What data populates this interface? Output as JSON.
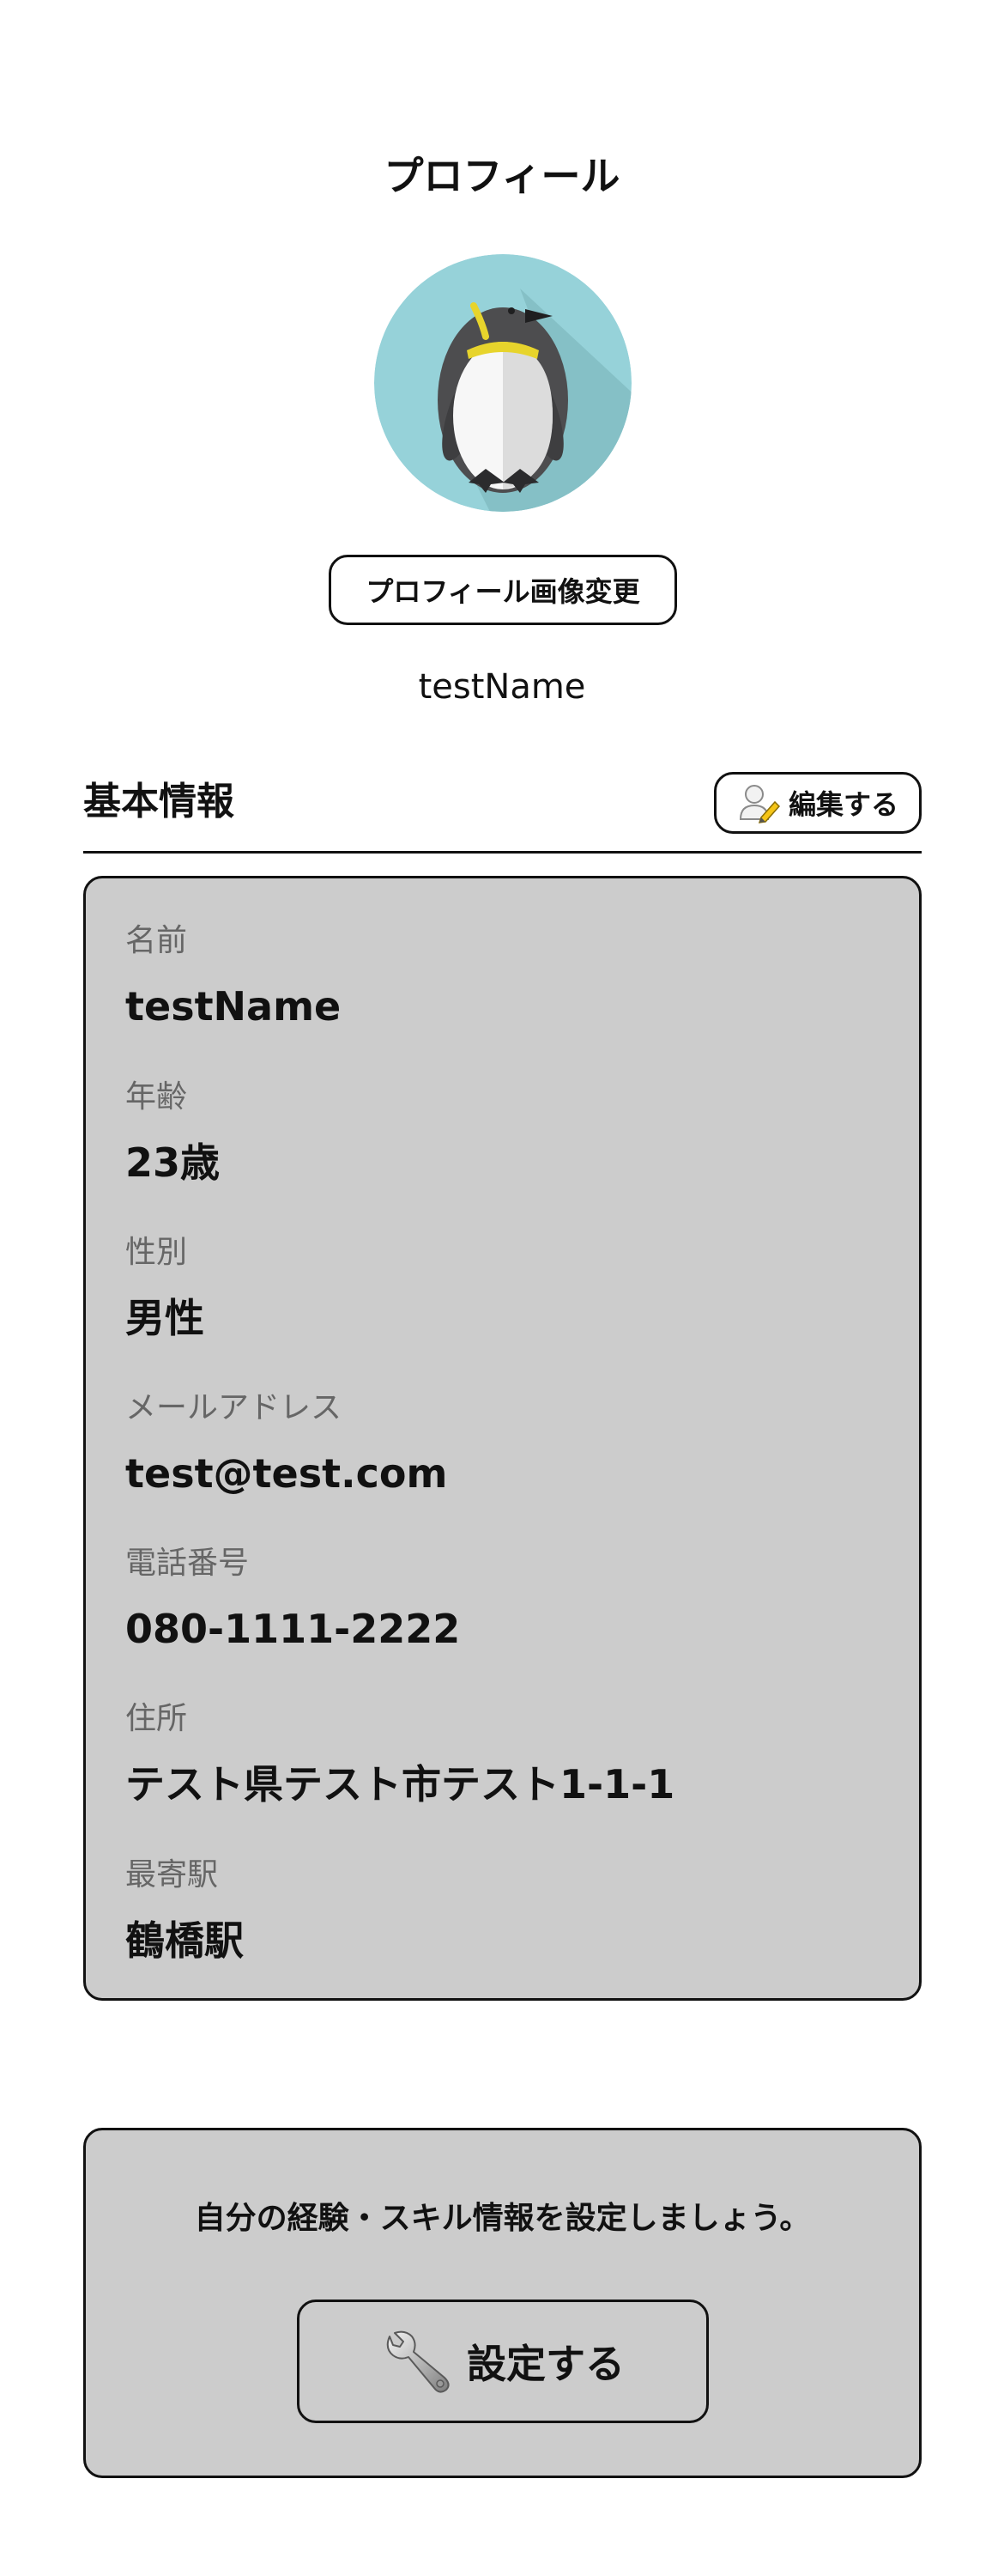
{
  "header": {
    "title": "プロフィール"
  },
  "profile": {
    "avatar_icon": "penguin-avatar",
    "change_photo_label": "プロフィール画像変更",
    "username": "testName"
  },
  "basic_info": {
    "section_title": "基本情報",
    "edit_label": "編集する",
    "edit_icon": "user-edit-icon",
    "fields": [
      {
        "label": "名前",
        "value": "testName"
      },
      {
        "label": "年齢",
        "value": "23歳"
      },
      {
        "label": "性別",
        "value": "男性"
      },
      {
        "label": "メールアドレス",
        "value": "test@test.com"
      },
      {
        "label": "電話番号",
        "value": "080-1111-2222"
      },
      {
        "label": "住所",
        "value": "テスト県テスト市テスト1-1-1"
      },
      {
        "label": "最寄駅",
        "value": "鶴橋駅"
      }
    ]
  },
  "skills": {
    "message": "自分の経験・スキル情報を設定しましょう。",
    "setup_label": "設定する",
    "setup_icon": "wrench-icon"
  },
  "colors": {
    "card_background": "#cccccc",
    "border": "#111111",
    "label_gray": "#666666",
    "avatar_background": "#96d2d9"
  }
}
